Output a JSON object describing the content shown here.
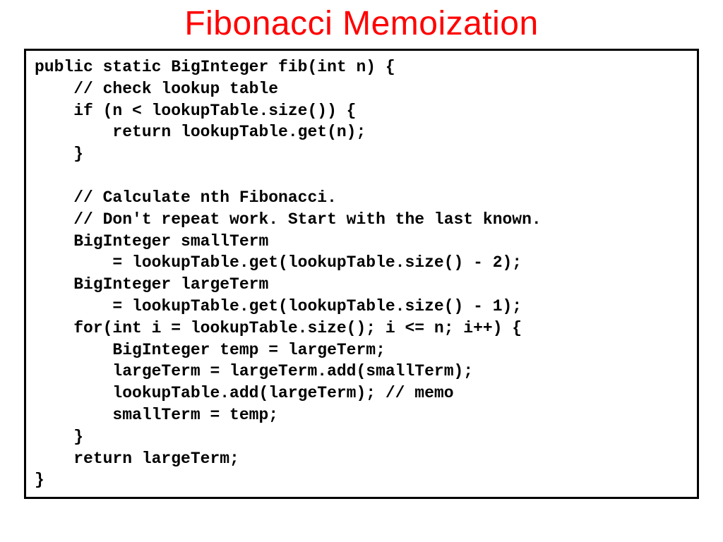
{
  "title": "Fibonacci Memoization",
  "code": "public static BigInteger fib(int n) {\n    // check lookup table\n    if (n < lookupTable.size()) {\n        return lookupTable.get(n);\n    }\n\n    // Calculate nth Fibonacci.\n    // Don't repeat work. Start with the last known.\n    BigInteger smallTerm\n        = lookupTable.get(lookupTable.size() - 2);\n    BigInteger largeTerm\n        = lookupTable.get(lookupTable.size() - 1);\n    for(int i = lookupTable.size(); i <= n; i++) {\n        BigInteger temp = largeTerm;\n        largeTerm = largeTerm.add(smallTerm);\n        lookupTable.add(largeTerm); // memo\n        smallTerm = temp;\n    }\n    return largeTerm;\n}"
}
